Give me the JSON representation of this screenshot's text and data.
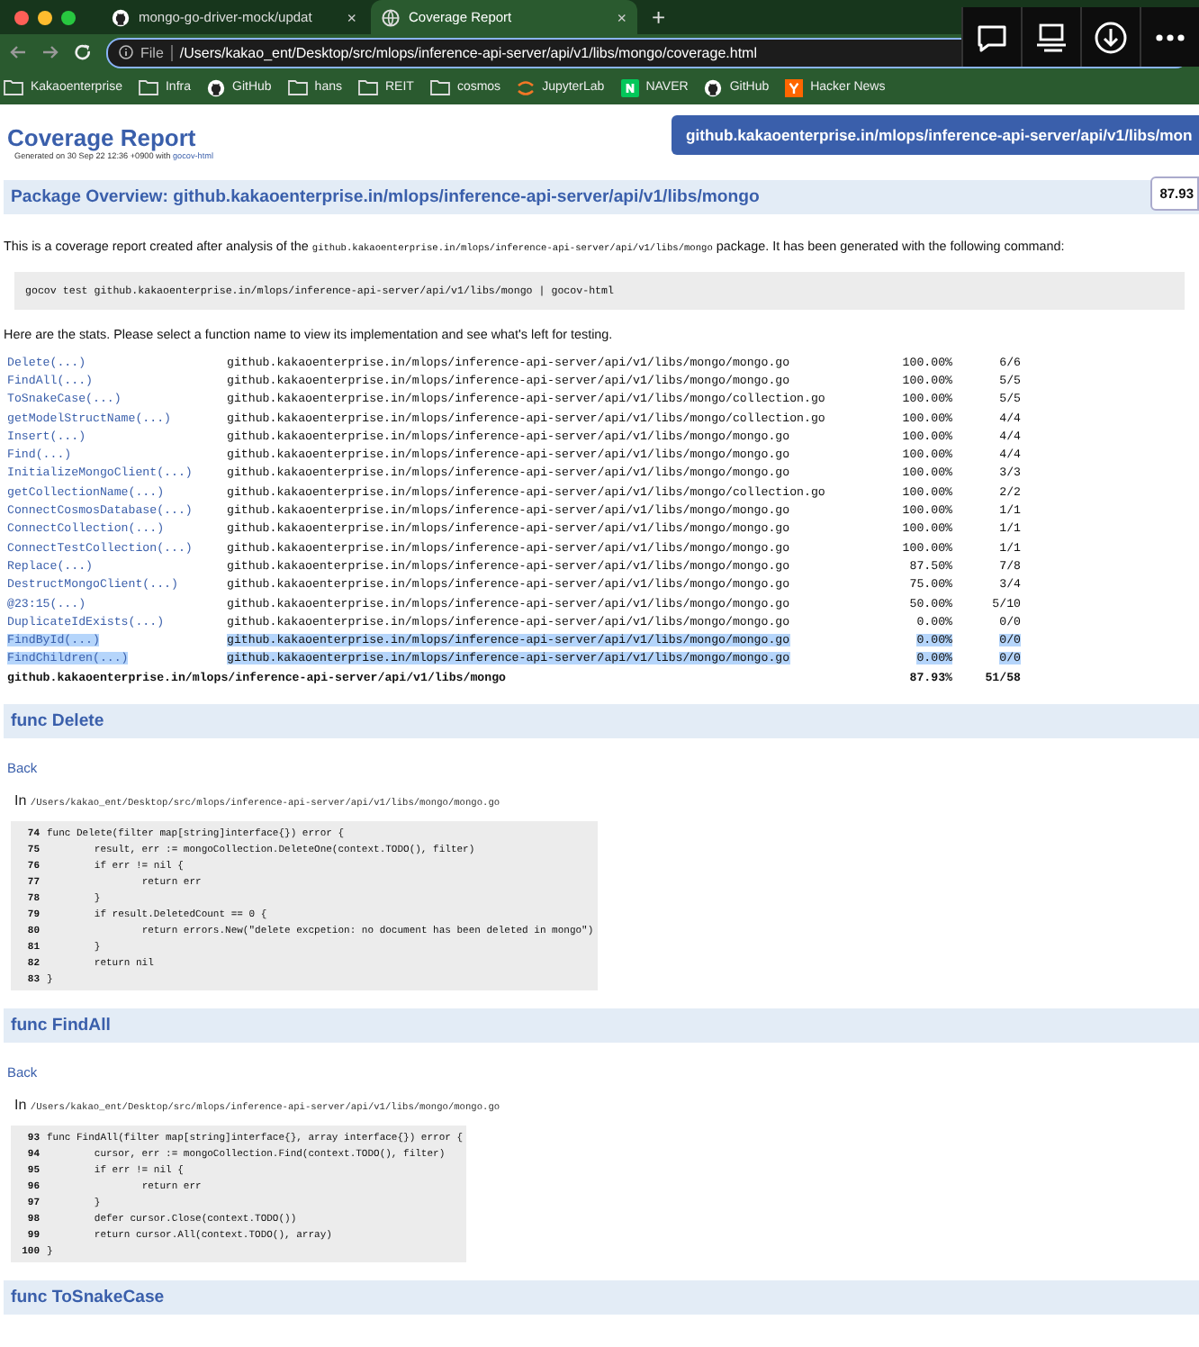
{
  "browser": {
    "tabs": [
      {
        "title": "mongo-go-driver-mock/updat",
        "kind": "github",
        "close": "×",
        "selected": false
      },
      {
        "title": "Coverage Report",
        "kind": "globe",
        "close": "×",
        "selected": true
      }
    ],
    "new_tab": "+",
    "address": {
      "scheme": "File",
      "url": "/Users/kakao_ent/Desktop/src/mlops/inference-api-server/api/v1/libs/mongo/coverage.html"
    },
    "bookmarks": [
      {
        "label": "Kakaoenterprise",
        "kind": "folder"
      },
      {
        "label": "Infra",
        "kind": "folder"
      },
      {
        "label": "GitHub",
        "kind": "github"
      },
      {
        "label": "hans",
        "kind": "folder"
      },
      {
        "label": "REIT",
        "kind": "folder"
      },
      {
        "label": "cosmos",
        "kind": "folder"
      },
      {
        "label": "JupyterLab",
        "kind": "jupyter"
      },
      {
        "label": "NAVER",
        "kind": "naver"
      },
      {
        "label": "GitHub",
        "kind": "github"
      },
      {
        "label": "Hacker News",
        "kind": "hn"
      }
    ]
  },
  "header": {
    "title": "Coverage Report",
    "generated": "Generated on 30 Sep 22 12:36 +0900 with",
    "generator_link": "gocov-html",
    "package_banner": "github.kakaoenterprise.in/mlops/inference-api-server/api/v1/libs/mon",
    "coverage_badge": "87.93"
  },
  "overview": {
    "heading": "Package Overview: github.kakaoenterprise.in/mlops/inference-api-server/api/v1/libs/mongo",
    "intro_before": "This is a coverage report created after analysis of the",
    "intro_package": "github.kakaoenterprise.in/mlops/inference-api-server/api/v1/libs/mongo",
    "intro_after": "package. It has been generated with the following command:",
    "command": "gocov test github.kakaoenterprise.in/mlops/inference-api-server/api/v1/libs/mongo | gocov-html",
    "stats_intro": "Here are the stats. Please select a function name to view its implementation and see what's left for testing."
  },
  "functions": [
    {
      "name": "Delete(...)",
      "file": "github.kakaoenterprise.in/mlops/inference-api-server/api/v1/libs/mongo/mongo.go",
      "percent": "100.00%",
      "count": "6/6",
      "highlighted": false
    },
    {
      "name": "FindAll(...)",
      "file": "github.kakaoenterprise.in/mlops/inference-api-server/api/v1/libs/mongo/mongo.go",
      "percent": "100.00%",
      "count": "5/5",
      "highlighted": false
    },
    {
      "name": "ToSnakeCase(...)",
      "file": "github.kakaoenterprise.in/mlops/inference-api-server/api/v1/libs/mongo/collection.go",
      "percent": "100.00%",
      "count": "5/5",
      "highlighted": false
    },
    {
      "name": "getModelStructName(...)",
      "file": "github.kakaoenterprise.in/mlops/inference-api-server/api/v1/libs/mongo/collection.go",
      "percent": "100.00%",
      "count": "4/4",
      "highlighted": false
    },
    {
      "name": "Insert(...)",
      "file": "github.kakaoenterprise.in/mlops/inference-api-server/api/v1/libs/mongo/mongo.go",
      "percent": "100.00%",
      "count": "4/4",
      "highlighted": false
    },
    {
      "name": "Find(...)",
      "file": "github.kakaoenterprise.in/mlops/inference-api-server/api/v1/libs/mongo/mongo.go",
      "percent": "100.00%",
      "count": "4/4",
      "highlighted": false
    },
    {
      "name": "InitializeMongoClient(...)",
      "file": "github.kakaoenterprise.in/mlops/inference-api-server/api/v1/libs/mongo/mongo.go",
      "percent": "100.00%",
      "count": "3/3",
      "highlighted": false
    },
    {
      "name": "getCollectionName(...)",
      "file": "github.kakaoenterprise.in/mlops/inference-api-server/api/v1/libs/mongo/collection.go",
      "percent": "100.00%",
      "count": "2/2",
      "highlighted": false
    },
    {
      "name": "ConnectCosmosDatabase(...)",
      "file": "github.kakaoenterprise.in/mlops/inference-api-server/api/v1/libs/mongo/mongo.go",
      "percent": "100.00%",
      "count": "1/1",
      "highlighted": false
    },
    {
      "name": "ConnectCollection(...)",
      "file": "github.kakaoenterprise.in/mlops/inference-api-server/api/v1/libs/mongo/mongo.go",
      "percent": "100.00%",
      "count": "1/1",
      "highlighted": false
    },
    {
      "name": "ConnectTestCollection(...)",
      "file": "github.kakaoenterprise.in/mlops/inference-api-server/api/v1/libs/mongo/mongo.go",
      "percent": "100.00%",
      "count": "1/1",
      "highlighted": false
    },
    {
      "name": "Replace(...)",
      "file": "github.kakaoenterprise.in/mlops/inference-api-server/api/v1/libs/mongo/mongo.go",
      "percent": "87.50%",
      "count": "7/8",
      "highlighted": false
    },
    {
      "name": "DestructMongoClient(...)",
      "file": "github.kakaoenterprise.in/mlops/inference-api-server/api/v1/libs/mongo/mongo.go",
      "percent": "75.00%",
      "count": "3/4",
      "highlighted": false
    },
    {
      "name": "@23:15(...)",
      "file": "github.kakaoenterprise.in/mlops/inference-api-server/api/v1/libs/mongo/mongo.go",
      "percent": "50.00%",
      "count": "5/10",
      "highlighted": false
    },
    {
      "name": "DuplicateIdExists(...)",
      "file": "github.kakaoenterprise.in/mlops/inference-api-server/api/v1/libs/mongo/mongo.go",
      "percent": "0.00%",
      "count": "0/0",
      "highlighted": false
    },
    {
      "name": "FindById(...)",
      "file": "github.kakaoenterprise.in/mlops/inference-api-server/api/v1/libs/mongo/mongo.go",
      "percent": "0.00%",
      "count": "0/0",
      "highlighted": true
    },
    {
      "name": "FindChildren(...)",
      "file": "github.kakaoenterprise.in/mlops/inference-api-server/api/v1/libs/mongo/mongo.go",
      "percent": "0.00%",
      "count": "0/0",
      "highlighted": true
    }
  ],
  "total": {
    "package": "github.kakaoenterprise.in/mlops/inference-api-server/api/v1/libs/mongo",
    "percent": "87.93%",
    "count": "51/58"
  },
  "sections": [
    {
      "heading": "func Delete",
      "back": "Back",
      "location_label": "In",
      "location": "/Users/kakao_ent/Desktop/src/mlops/inference-api-server/api/v1/libs/mongo/mongo.go",
      "lines": [
        {
          "number": "74",
          "code": "func Delete(filter map[string]interface{}) error {"
        },
        {
          "number": "75",
          "code": "\tresult, err := mongoCollection.DeleteOne(context.TODO(), filter)"
        },
        {
          "number": "76",
          "code": "\tif err != nil {"
        },
        {
          "number": "77",
          "code": "\t\treturn err"
        },
        {
          "number": "78",
          "code": "\t}"
        },
        {
          "number": "79",
          "code": "\tif result.DeletedCount == 0 {"
        },
        {
          "number": "80",
          "code": "\t\treturn errors.New(\"delete excpetion: no document has been deleted in mongo\")"
        },
        {
          "number": "81",
          "code": "\t}"
        },
        {
          "number": "82",
          "code": "\treturn nil"
        },
        {
          "number": "83",
          "code": "}"
        }
      ]
    },
    {
      "heading": "func FindAll",
      "back": "Back",
      "location_label": "In",
      "location": "/Users/kakao_ent/Desktop/src/mlops/inference-api-server/api/v1/libs/mongo/mongo.go",
      "lines": [
        {
          "number": "93",
          "code": "func FindAll(filter map[string]interface{}, array interface{}) error {"
        },
        {
          "number": "94",
          "code": "\tcursor, err := mongoCollection.Find(context.TODO(), filter)"
        },
        {
          "number": "95",
          "code": "\tif err != nil {"
        },
        {
          "number": "96",
          "code": "\t\treturn err"
        },
        {
          "number": "97",
          "code": "\t}"
        },
        {
          "number": "98",
          "code": "\tdefer cursor.Close(context.TODO())"
        },
        {
          "number": "99",
          "code": "\treturn cursor.All(context.TODO(), array)"
        },
        {
          "number": "100",
          "code": "}"
        }
      ]
    },
    {
      "heading": "func ToSnakeCase"
    }
  ]
}
